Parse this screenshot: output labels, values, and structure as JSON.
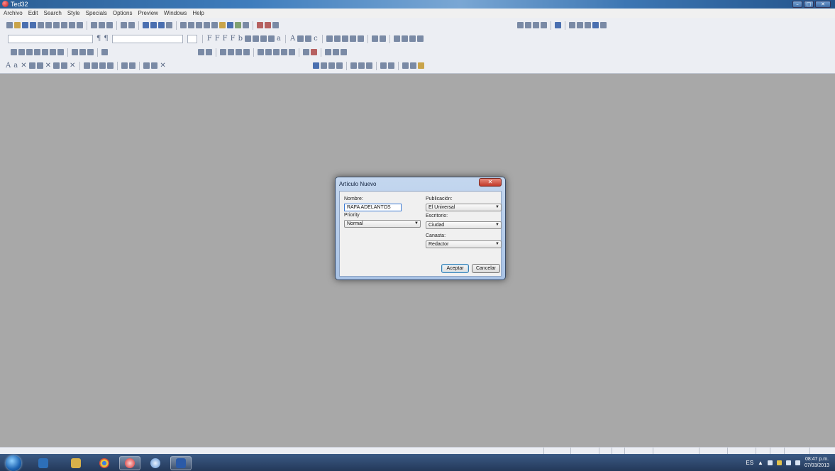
{
  "window": {
    "title": "Ted32",
    "minimize_glyph": "–",
    "maximize_glyph": "□",
    "close_glyph": "✕"
  },
  "menubar": {
    "items": [
      "Archivo",
      "Edit",
      "Search",
      "Style",
      "Specials",
      "Options",
      "Preview",
      "Windows",
      "Help"
    ]
  },
  "dialog": {
    "title": "Artículo Nuevo",
    "close_glyph": "✕",
    "nombre_label": "Nombre:",
    "nombre_value": "RAFA  ADELANTOS",
    "priority_label": "Priority",
    "priority_value": "Normal",
    "publicacion_label": "Publicación:",
    "publicacion_value": "El Universal",
    "escritorio_label": "Escritorio:",
    "escritorio_value": "Ciudad",
    "canasta_label": "Canasta:",
    "canasta_value": "Redactor",
    "accept_label": "Aceptar",
    "cancel_label": "Cancelar",
    "dropdown_glyph": "▼"
  },
  "taskbar": {
    "language": "ES",
    "time": "08:47 p.m.",
    "date": "07/03/2013"
  },
  "colors": {
    "desktop_bg": "#a8a8a8",
    "titlebar_blue": "#3e7dbd",
    "dialog_frame": "#a9c3e6",
    "close_red": "#c1392a"
  }
}
